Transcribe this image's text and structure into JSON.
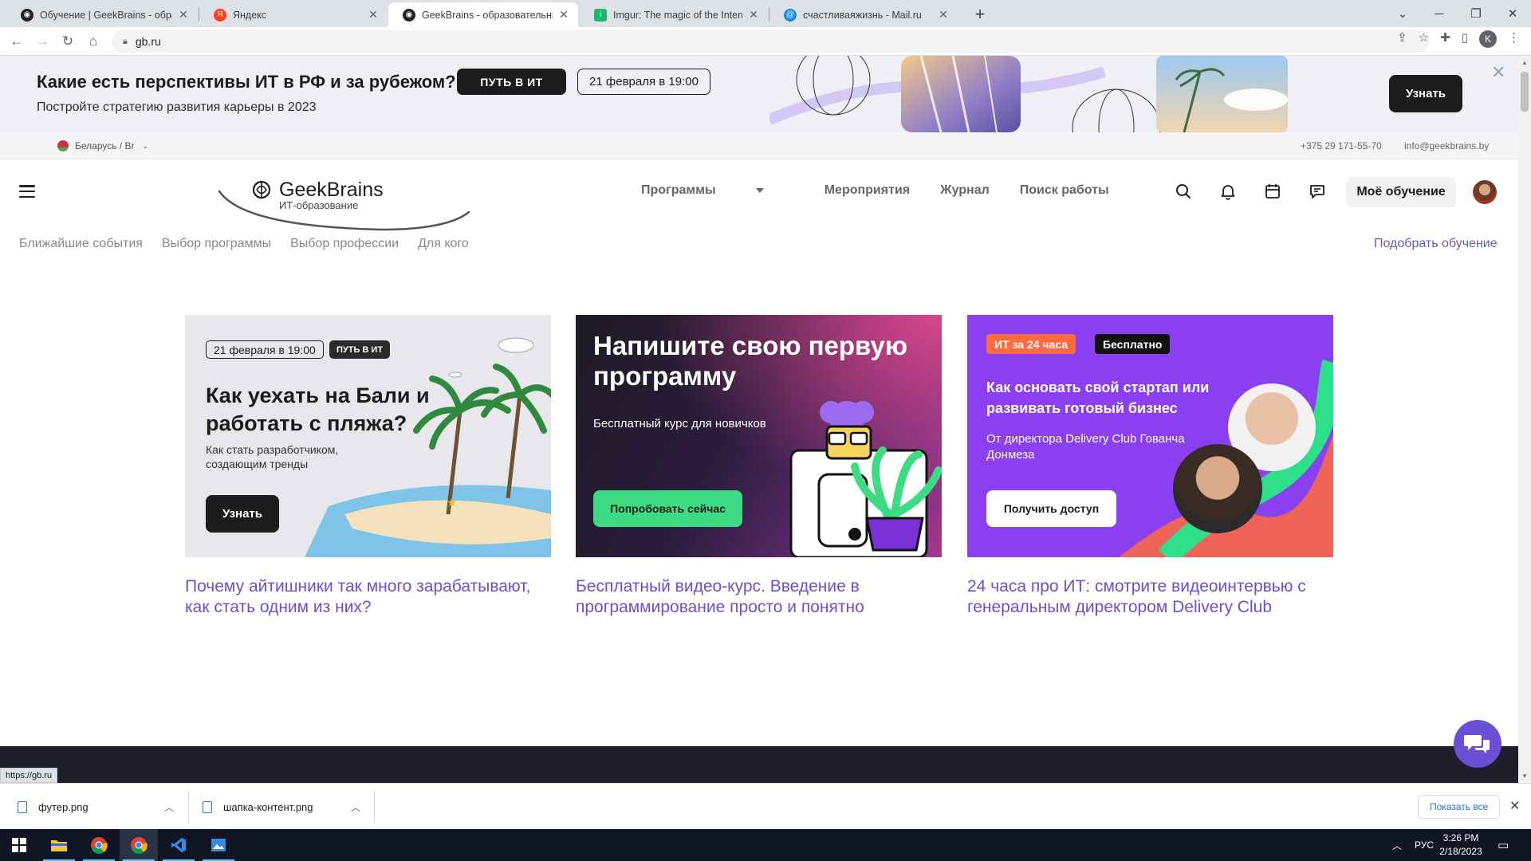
{
  "browser": {
    "tabs": [
      {
        "title": "Обучение | GeekBrains - образо",
        "icon": "geekbrains-icon",
        "active": false
      },
      {
        "title": "Яндекс",
        "icon": "yandex-icon",
        "active": false
      },
      {
        "title": "GeekBrains - образовательный",
        "icon": "geekbrains-icon",
        "active": true
      },
      {
        "title": "Imgur: The magic of the Internet",
        "icon": "imgur-icon",
        "active": false
      },
      {
        "title": "счастливаяжизнь - Mail.ru",
        "icon": "mailru-icon",
        "active": false
      }
    ],
    "url": "gb.ru",
    "profile_initial": "K",
    "status_url": "https://gb.ru"
  },
  "promo": {
    "title": "Какие есть перспективы ИТ в РФ и за рубежом?",
    "subtitle": "Постройте стратегию развития карьеры в 2023",
    "chip_dark": "ПУТЬ В ИТ",
    "chip_date": "21 февраля в 19:00",
    "button": "Узнать"
  },
  "infobar": {
    "region": "Беларусь / Br",
    "phone": "+375 29 171-55-70",
    "email": "info@geekbrains.by"
  },
  "header": {
    "logo_name": "GeekBrains",
    "logo_sub": "ИТ-образование",
    "nav": [
      "Программы",
      "Мероприятия",
      "Журнал",
      "Поиск работы"
    ],
    "my_learning": "Моё обучение"
  },
  "subnav": {
    "items": [
      "Ближайшие события",
      "Выбор программы",
      "Выбор профессии",
      "Для кого"
    ],
    "pick": "Подобрать обучение"
  },
  "cards": [
    {
      "date": "21 февраля в 19:00",
      "tag": "ПУТЬ В ИТ",
      "heading": "Как уехать на Бали и работать с пляжа?",
      "text": "Как стать разработчиком, создающим тренды",
      "button": "Узнать",
      "link": "Почему айтишники так много зарабатывают, как стать одним из них?"
    },
    {
      "heading": "Напишите свою первую программу",
      "text": "Бесплатный курс для новичков",
      "button": "Попробовать сейчас",
      "link": "Бесплатный видео-курс. Введение в программирование просто и понятно"
    },
    {
      "tag1": "ИТ за 24 часа",
      "tag2": "Бесплатно",
      "heading": "Как основать свой стартап или развивать готовый бизнес",
      "text": "От директора Delivery Club Гованча Донмеза",
      "button": "Получить доступ",
      "link": "24 часа про ИТ: смотрите видеоинтервью с генеральным директором Delivery Club"
    }
  ],
  "downloads": {
    "files": [
      "футер.png",
      "шапка-контент.png"
    ],
    "show_all": "Показать все"
  },
  "taskbar": {
    "lang": "РУС",
    "time": "3:26 PM",
    "date": "2/18/2023"
  },
  "colors": {
    "accent_purple": "#6b4fd6",
    "card3_bg": "#8a3ff0",
    "card2_button": "#3ddc84",
    "tag_orange": "#ff6b3d"
  }
}
